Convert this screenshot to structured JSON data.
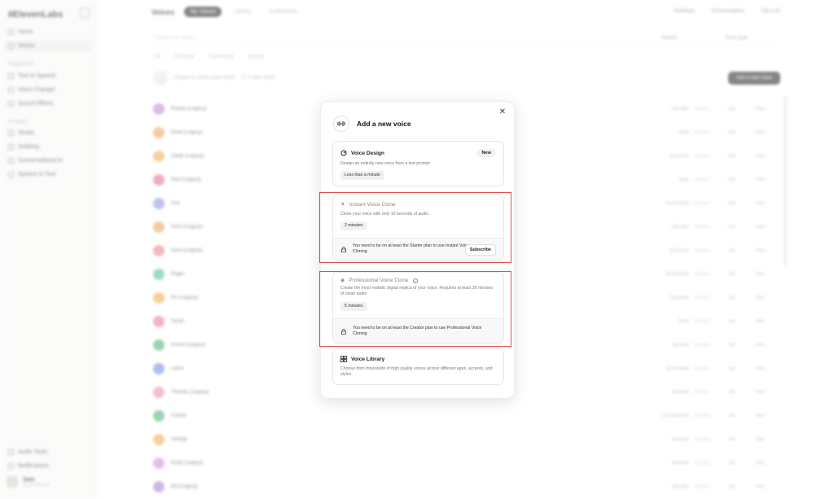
{
  "sidebar": {
    "logo": "IIElevenLabs",
    "items": [
      {
        "label": "Home"
      },
      {
        "label": "Voices"
      },
      {
        "label": "Text to Speech"
      },
      {
        "label": "Voice Changer"
      },
      {
        "label": "Sound Effects"
      },
      {
        "label": "Studio"
      },
      {
        "label": "Dubbing"
      },
      {
        "label": "Conversational AI"
      },
      {
        "label": "Speech to Text"
      }
    ],
    "sections": [
      "Playground",
      "Products"
    ],
    "bottom": [
      {
        "label": "Audio Tools"
      },
      {
        "label": "Notifications"
      }
    ],
    "user": {
      "name": "Sam",
      "sub": "My Workspace"
    }
  },
  "header": {
    "title": "Voices",
    "tabs": [
      "My Voices",
      "Library",
      "Collections"
    ],
    "right": [
      "Feedback",
      "Documentation",
      "Talk to El"
    ]
  },
  "toolbar": {
    "search_placeholder": "Search my voices...",
    "sort": "Recent",
    "type": "Voice type",
    "filters": [
      "All",
      "Personal",
      "Community",
      "Default"
    ],
    "create": "Create or clone a new voice",
    "create_sub": "3 / 3 slots used",
    "add_button": "Add a new voice"
  },
  "voices": [
    {
      "name": "Rachel (Legacy)",
      "cat": "Narration",
      "color": "#c77dd6"
    },
    {
      "name": "Drew (Legacy)",
      "cat": "News",
      "color": "#e8a15a"
    },
    {
      "name": "Clyde (Legacy)",
      "cat": "Characters",
      "color": "#e9b04d"
    },
    {
      "name": "Paul (Legacy)",
      "cat": "News",
      "color": "#e06c8c"
    },
    {
      "name": "Aria",
      "cat": "Social media",
      "color": "#8b8fe0"
    },
    {
      "name": "Domi (Legacy)",
      "cat": "Narration",
      "color": "#e8a15a"
    },
    {
      "name": "Dave (Legacy)",
      "cat": "Characters",
      "color": "#e67d8a"
    },
    {
      "name": "Roger",
      "cat": "Social media",
      "color": "#4fbf8f"
    },
    {
      "name": "Fin (Legacy)",
      "cat": "Characters",
      "color": "#ebaa4a"
    },
    {
      "name": "Sarah",
      "cat": "News",
      "color": "#e8759a"
    },
    {
      "name": "Antoni (Legacy)",
      "cat": "Narration",
      "color": "#4caf6e"
    },
    {
      "name": "Laura",
      "cat": "Social media",
      "color": "#6c86e0"
    },
    {
      "name": "Thomas (Legacy)",
      "cat": "Narration",
      "color": "#e78aa0"
    },
    {
      "name": "Charlie",
      "cat": "Conversational",
      "color": "#4caf6e"
    },
    {
      "name": "George",
      "cat": "Narration",
      "color": "#ebaa4a"
    },
    {
      "name": "Emily (Legacy)",
      "cat": "Narration",
      "color": "#d08ad9"
    },
    {
      "name": "Elli (Legacy)",
      "cat": "Narration",
      "color": "#b07ad6"
    }
  ],
  "voice_actions": {
    "tag": "+4 more...",
    "use": "Use",
    "view": "View"
  },
  "modal": {
    "title": "Add a new voice",
    "close_icon": "close-icon",
    "options": [
      {
        "title": "Voice Design",
        "badge": "New",
        "desc": "Design an entirely new voice from a text prompt.",
        "time": "Less than a minute"
      },
      {
        "title": "Instant Voice Clone",
        "desc": "Clone your voice with only 10 seconds of audio.",
        "time": "2 minutes",
        "lock": "You need to be on at least the Starter plan to use Instant Voice Cloning",
        "action": "Subscribe"
      },
      {
        "title": "Professional Voice Clone",
        "desc": "Create the most realistic digital replica of your voice. Requires at least 30 minutes of clean audio.",
        "time": "5 minutes",
        "lock": "You need to be on at least the Creator plan to use Professional Voice Cloning"
      },
      {
        "title": "Voice Library",
        "desc": "Choose from thousands of high quality voices across different ages, accents, and styles."
      }
    ]
  },
  "colors": {
    "highlight": "#d9534f",
    "accent_dark": "#222222"
  }
}
